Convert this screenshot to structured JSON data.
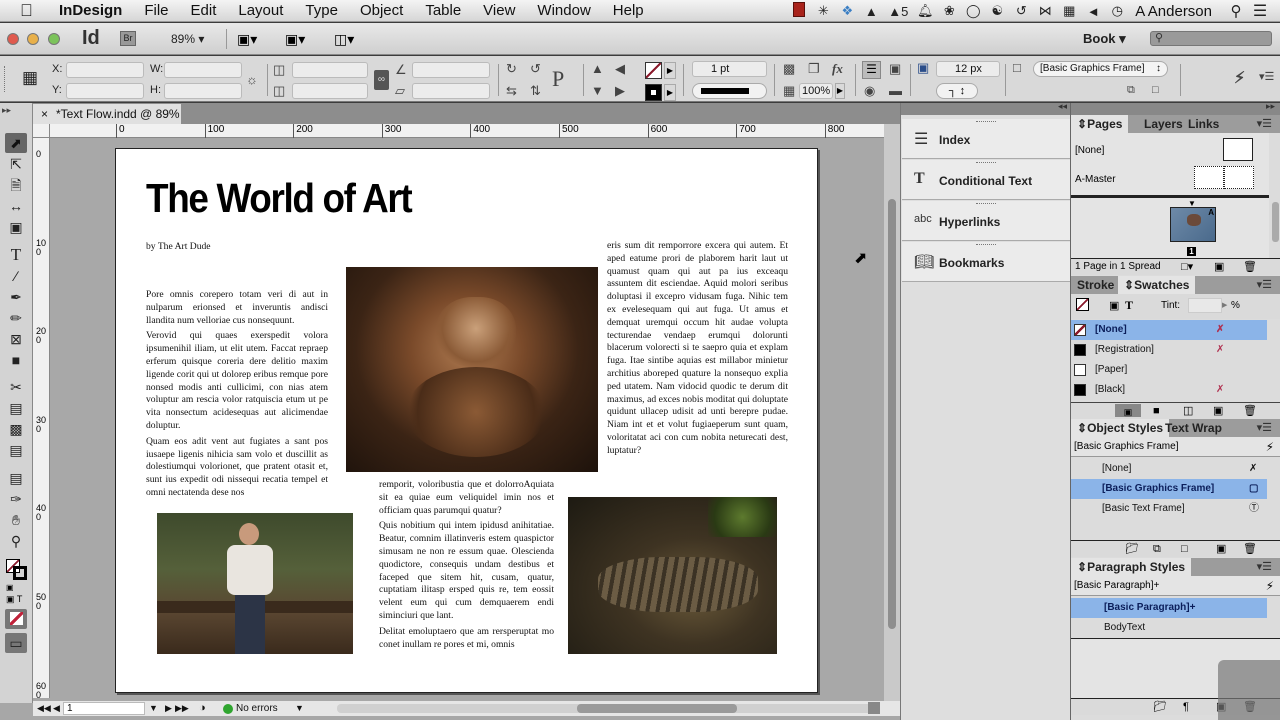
{
  "menubar": {
    "app": "InDesign",
    "items": [
      "File",
      "Edit",
      "Layout",
      "Type",
      "Object",
      "Table",
      "View",
      "Window",
      "Help"
    ],
    "status_icons": [
      "film-icon",
      "sparkle-icon",
      "dropbox-icon",
      "flask-icon",
      "stamp-icon",
      "bell-icon",
      "paw-icon",
      "chat-icon",
      "accessibility-icon",
      "time-machine-icon",
      "bluetooth-icon",
      "calendar-icon",
      "volume-icon",
      "clock-icon"
    ],
    "badge_count": "5",
    "user": "A Anderson"
  },
  "appbar": {
    "logo": "Id",
    "bridge": "Br",
    "zoom": "89%",
    "workspace": "Book",
    "search_placeholder": ""
  },
  "control": {
    "x_label": "X:",
    "y_label": "Y:",
    "w_label": "W:",
    "h_label": "H:",
    "stroke_weight": "1 pt",
    "opacity": "100%",
    "corner_size": "12 px",
    "object_style": "[Basic Graphics Frame]"
  },
  "document": {
    "tab_title": "*Text Flow.indd @ 89%",
    "hruler": [
      "0",
      "100",
      "200",
      "300",
      "400",
      "500",
      "600",
      "700",
      "800"
    ],
    "vruler": [
      "0",
      "100",
      "200",
      "300",
      "400",
      "500",
      "600"
    ],
    "title": "The World of Art",
    "byline": "by The Art Dude",
    "col1": [
      "Pore omnis corepero totam veri di aut in nulparum erionsed et inveruntis andisci llandita num velloriae cus nonsequunt.",
      "Verovid qui quaes exerspedit volora ipsumenihil iliam, ut elit utem. Faccat repraep erferum quisque coreria dere delitio maxim ligende corit qui ut dolorep eribus remque pore nonsed modis anti cullicimi, con nias atem voluptur am rescia volor ratquiscia etum ut pe vita nonsectum acidesequas aut alicimendae doluptur.",
      "Quam eos adit vent aut fugiates a sant pos iusaepe ligenis nihicia sam volo et duscillit as dolestiumqui volorionet, que pratent otasit et, sunt ius expedit odi nissequi recatia tempel et omni nectatenda dese nos"
    ],
    "col2": [
      "remporit, voloribustia que et dolorroAquiata sit ea quiae eum veliquidel imin nos et officiam quas parumqui quatur?",
      "Quis nobitium qui intem ipidusd anihitatiae. Beatur, comnim illatinveris estem quaspictor simusam ne non re essum quae. Olescienda quodictore, consequis undam destibus et faceped que sitem hit, cusam, quatur, cuptatiam ilitasp ersped quis re, tem eossit velent eum qui cum demquaerem endi siminciuri que lant.",
      "Delitat emoluptaero que am rersperuptat mo conet inullam re pores et mi, omnis"
    ],
    "col3": [
      "eris sum dit remporrore excera qui autem. Et aped eatume prori de plaborem harit laut ut quamust quam qui aut pa ius exceaqu assuntem dit esciendae. Aquid molori seribus doluptasi il excepro vidusam fuga. Nihic tem ex evelesequam qui aut fuga. Ut amus et demquat uremqui occum hit audae volupta tecturendae vendaep erumqui dolorunti blacerum volorecti si te saepro quia et explam fuga. Itae sintibe aquias est millabor minietur architius aboreped quature la nonsequo explia ped utatem. Nam vidocid quodic te derum dit maximus, ad exces nobis moditat qui doluptate quidunt ullacep udisit ad unti berepre pudae. Niam int et et volut fugiaeperum sunt quam, voloritatat aci con cum nobita neturecati dest, luptatur?"
    ]
  },
  "statusbar": {
    "page": "1",
    "preflight": "No errors"
  },
  "collapsed_panels": [
    {
      "label": "Index",
      "icon": "index-icon"
    },
    {
      "label": "Conditional Text",
      "icon": "conditional-text-icon"
    },
    {
      "label": "Hyperlinks",
      "icon": "hyperlinks-icon"
    },
    {
      "label": "Bookmarks",
      "icon": "bookmarks-icon"
    }
  ],
  "pages_panel": {
    "tabs": [
      "Pages",
      "Layers",
      "Links"
    ],
    "masters": [
      "[None]",
      "A-Master"
    ],
    "page_number": "1",
    "master_prefix": "A",
    "footer": "1 Page in 1 Spread"
  },
  "swatches_panel": {
    "tabs": [
      "Stroke",
      "Swatches"
    ],
    "tint_label": "Tint:",
    "tint_value": "",
    "percent": "%",
    "swatches": [
      {
        "name": "[None]",
        "color": "none",
        "selected": true
      },
      {
        "name": "[Registration]",
        "color": "#000000",
        "selected": false
      },
      {
        "name": "[Paper]",
        "color": "#ffffff",
        "selected": false
      },
      {
        "name": "[Black]",
        "color": "#000000",
        "selected": false
      }
    ]
  },
  "object_styles_panel": {
    "tabs": [
      "Object Styles",
      "Text Wrap"
    ],
    "current": "[Basic Graphics Frame]",
    "styles": [
      {
        "name": "[None]",
        "selected": false
      },
      {
        "name": "[Basic Graphics Frame]",
        "selected": true
      },
      {
        "name": "[Basic Text Frame]",
        "selected": false
      }
    ]
  },
  "paragraph_styles_panel": {
    "title": "Paragraph Styles",
    "current": "[Basic Paragraph]+",
    "styles": [
      {
        "name": "[Basic Paragraph]+",
        "selected": true
      },
      {
        "name": "BodyText",
        "selected": false
      }
    ]
  },
  "colors": {
    "selection": "#8bb4e8",
    "preflight_ok": "#2fa52f"
  }
}
